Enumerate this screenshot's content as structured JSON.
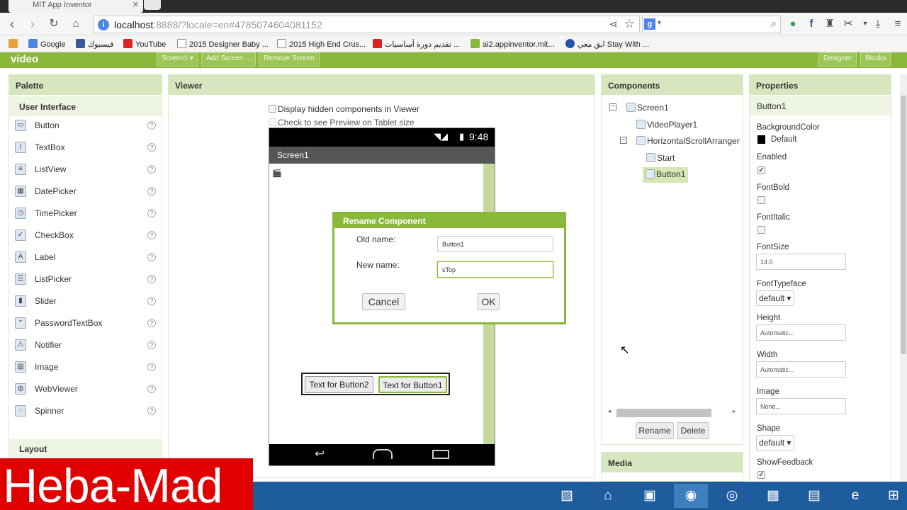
{
  "browser": {
    "tab_title": "MIT App Inventor",
    "url_host": "localhost",
    "url_rest": ":8888/?locale=en#4785074604081152",
    "bookmarks": [
      "Google",
      "فيسبوك",
      "YouTube",
      "2015 Designer Baby ...",
      "2015 High End Crus...",
      "تقديم دورة أساسيات ...",
      "ai2.appinventor.mit...",
      "ابق معي Stay With ..."
    ]
  },
  "app": {
    "project_name": "video",
    "screen_select": "Screen1 ▾",
    "add_screen": "Add Screen ...",
    "remove_screen": "Remove Screen",
    "designer": "Designer",
    "blocks": "Blocks"
  },
  "palette": {
    "title": "Palette",
    "category": "User Interface",
    "items": [
      {
        "label": "Button",
        "icon": "button-icon"
      },
      {
        "label": "TextBox",
        "icon": "textbox-icon"
      },
      {
        "label": "ListView",
        "icon": "listview-icon"
      },
      {
        "label": "DatePicker",
        "icon": "datepicker-icon"
      },
      {
        "label": "TimePicker",
        "icon": "timepicker-icon"
      },
      {
        "label": "CheckBox",
        "icon": "checkbox-icon"
      },
      {
        "label": "Label",
        "icon": "label-icon"
      },
      {
        "label": "ListPicker",
        "icon": "listpicker-icon"
      },
      {
        "label": "Slider",
        "icon": "slider-icon"
      },
      {
        "label": "PasswordTextBox",
        "icon": "password-icon"
      },
      {
        "label": "Notifier",
        "icon": "notifier-icon"
      },
      {
        "label": "Image",
        "icon": "image-icon"
      },
      {
        "label": "WebViewer",
        "icon": "webviewer-icon"
      },
      {
        "label": "Spinner",
        "icon": "spinner-icon"
      }
    ],
    "layout": "Layout"
  },
  "viewer": {
    "title": "Viewer",
    "display_hidden": "Display hidden components in Viewer",
    "tablet_preview": "Check to see Preview on Tablet size",
    "time": "9:48",
    "screen_title": "Screen1",
    "button2": "Text for Button2",
    "button1": "Text for Button1"
  },
  "dialog": {
    "title": "Rename Component",
    "old_label": "Old name:",
    "old_value": "Button1",
    "new_label": "New name:",
    "new_value": "sTop",
    "cancel": "Cancel",
    "ok": "OK"
  },
  "components": {
    "title": "Components",
    "screen": "Screen1",
    "video": "VideoPlayer1",
    "hsa": "HorizontalScrollArrangem",
    "start": "Start",
    "button1": "Button1",
    "rename": "Rename",
    "delete": "Delete",
    "media": "Media"
  },
  "properties": {
    "title": "Properties",
    "selected": "Button1",
    "background_color_label": "BackgroundColor",
    "background_color_value": "Default",
    "enabled_label": "Enabled",
    "fontbold_label": "FontBold",
    "fontitalic_label": "FontItalic",
    "fontsize_label": "FontSize",
    "fontsize_value": "14.0",
    "fonttypeface_label": "FontTypeface",
    "fonttypeface_value": "default ▾",
    "height_label": "Height",
    "height_value": "Automatic...",
    "width_label": "Width",
    "width_value": "Automatic...",
    "image_label": "Image",
    "image_value": "None...",
    "shape_label": "Shape",
    "shape_value": "default ▾",
    "showfeedback_label": "ShowFeedback",
    "enabled": true,
    "fontbold": false,
    "fontitalic": false,
    "showfeedback": true
  },
  "watermark": "Heba-Mad",
  "colors": {
    "accent": "#8ab83a",
    "watermark": "#e00000",
    "taskbar": "#1f5c9e"
  }
}
